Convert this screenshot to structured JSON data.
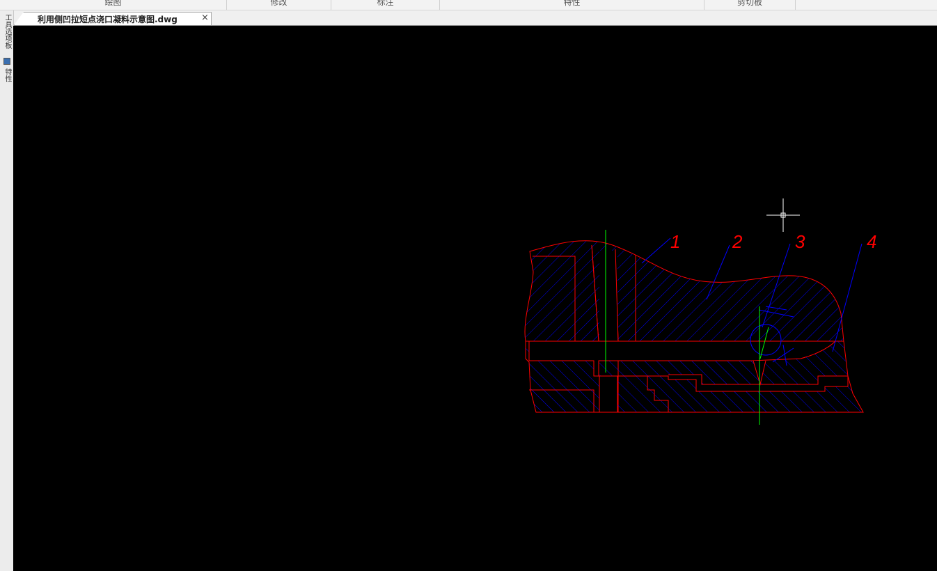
{
  "ribbon": {
    "groups": [
      "绘图",
      "修改",
      "标注",
      "特性",
      "剪切板"
    ]
  },
  "document_tab": {
    "title": "利用侧凹拉短点浇口凝料示意图.dwg",
    "close_label": "×"
  },
  "side_panel": {
    "tabs": [
      "工具选项板",
      "特性"
    ]
  },
  "drawing": {
    "background": "#000000",
    "outline_color": "#ff0000",
    "hatch_color": "#0000ff",
    "centerline_color": "#00ff00",
    "crosshair_color": "#ffffff",
    "callout_labels": [
      "1",
      "2",
      "3",
      "4"
    ]
  }
}
